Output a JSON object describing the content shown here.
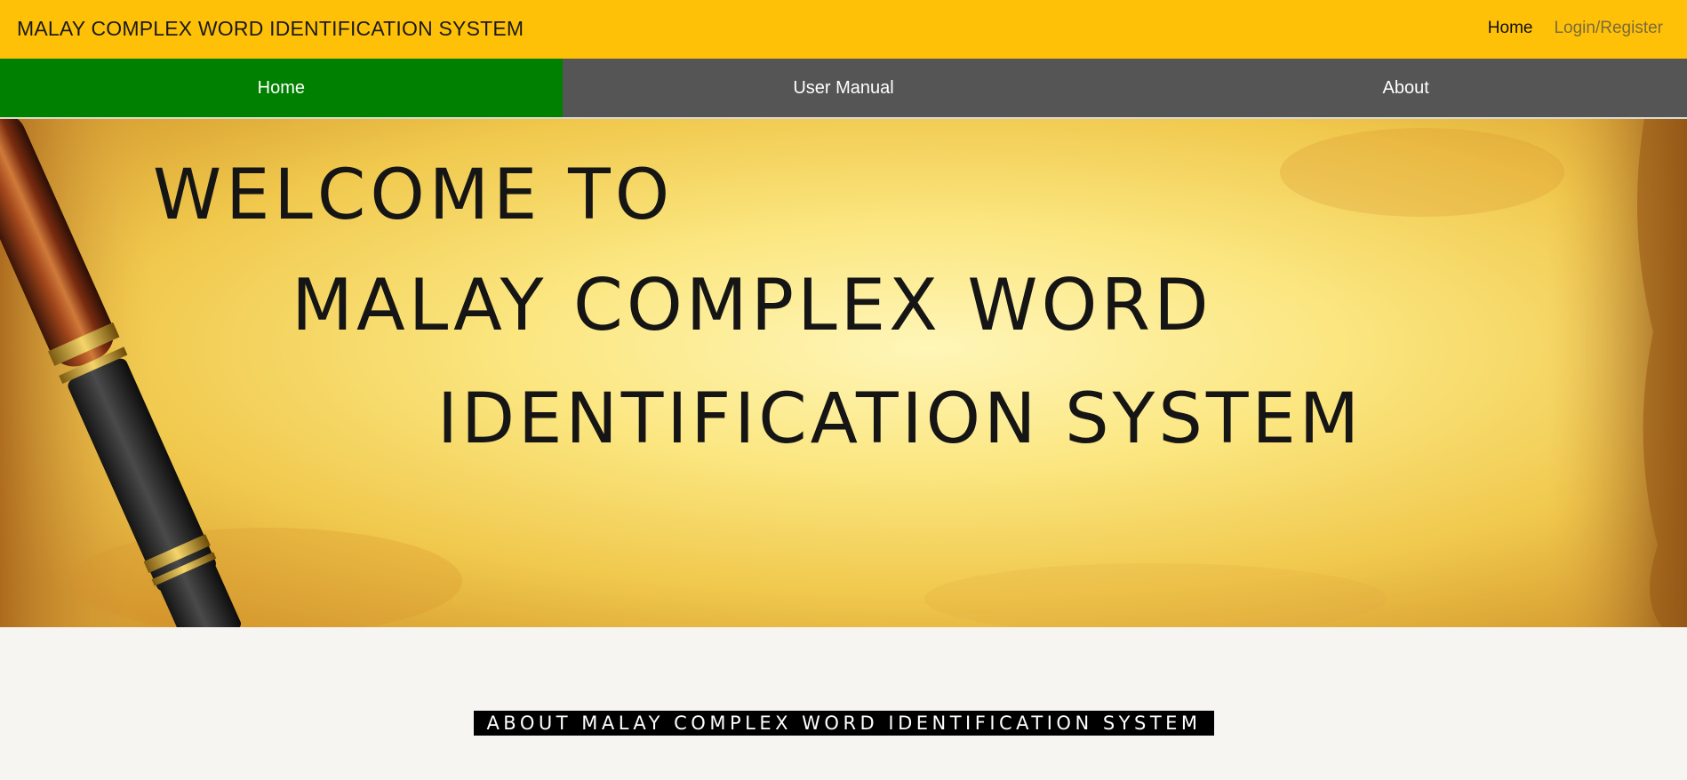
{
  "header": {
    "brand": "MALAY COMPLEX WORD IDENTIFICATION SYSTEM",
    "links": [
      {
        "label": "Home",
        "active": true
      },
      {
        "label": "Login/Register",
        "active": false
      }
    ],
    "background": "#ffc107"
  },
  "nav": {
    "tabs": [
      {
        "label": "Home",
        "active": true
      },
      {
        "label": "User Manual",
        "active": false
      },
      {
        "label": "About",
        "active": false
      }
    ],
    "active_color": "#008000",
    "inactive_color": "#555555"
  },
  "hero": {
    "line1": "WELCOME TO",
    "line2": "MALAY COMPLEX WORD",
    "line3": "IDENTIFICATION SYSTEM",
    "illustration": "fountain-pen-on-parchment-scroll"
  },
  "about": {
    "heading": "ABOUT MALAY COMPLEX WORD IDENTIFICATION SYSTEM"
  }
}
